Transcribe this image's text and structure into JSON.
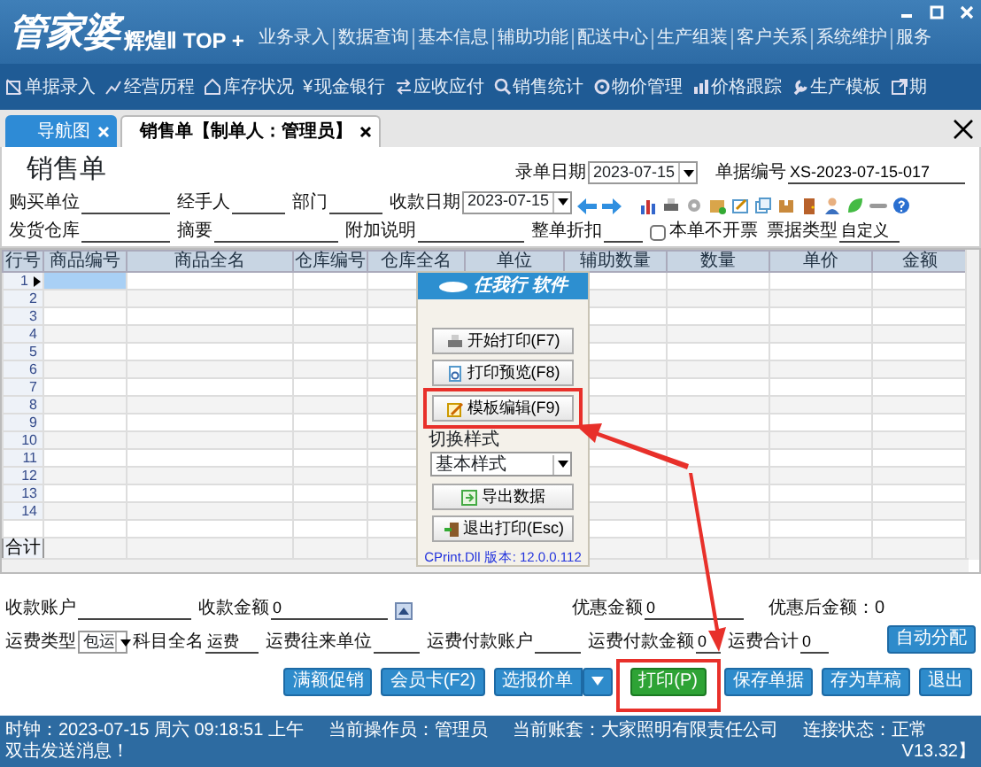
{
  "app": {
    "logo": "管家婆",
    "edition": "辉煌Ⅱ TOP +",
    "menu": [
      "业务录入",
      "数据查询",
      "基本信息",
      "辅助功能",
      "配送中心",
      "生产组装",
      "客户关系",
      "系统维护",
      "服务"
    ]
  },
  "toolbar": [
    {
      "label": "单据录入"
    },
    {
      "label": "经营历程"
    },
    {
      "label": "库存状况"
    },
    {
      "label": "现金银行",
      "glyph": "¥"
    },
    {
      "label": "应收应付"
    },
    {
      "label": "销售统计"
    },
    {
      "label": "物价管理"
    },
    {
      "label": "价格跟踪"
    },
    {
      "label": "生产模板"
    },
    {
      "label": "期"
    }
  ],
  "tabs": [
    {
      "label": "导航图",
      "selected": false
    },
    {
      "label": "销售单【制单人：管理员】",
      "selected": true
    }
  ],
  "form": {
    "title": "销售单",
    "entry_date": {
      "label": "录单日期",
      "value": "2023-07-15"
    },
    "doc_no": {
      "label": "单据编号",
      "value": "XS-2023-07-15-017"
    },
    "row1": [
      {
        "label": "购买单位"
      },
      {
        "label": "经手人"
      },
      {
        "label": "部门"
      },
      {
        "label": "收款日期",
        "value": "2023-07-15",
        "kind": "select"
      }
    ],
    "row2": [
      {
        "label": "发货仓库"
      },
      {
        "label": "摘要"
      },
      {
        "label": "附加说明"
      },
      {
        "label": "整单折扣"
      }
    ],
    "no_invoice": {
      "label": "本单不开票",
      "checked": false
    },
    "invoice_type": {
      "label": "票据类型",
      "value": "自定义"
    }
  },
  "grid": {
    "columns": [
      "行号",
      "商品编号",
      "商品全名",
      "仓库编号",
      "仓库全名",
      "单位",
      "辅助数量",
      "数量",
      "单价",
      "金额"
    ],
    "rows": [
      {
        "no": "1",
        "selected": true
      },
      {
        "no": "2",
        "selected": false
      },
      {
        "no": "3",
        "selected": false
      },
      {
        "no": "4",
        "selected": false
      },
      {
        "no": "5",
        "selected": false
      },
      {
        "no": "6",
        "selected": false
      },
      {
        "no": "7",
        "selected": false
      },
      {
        "no": "8",
        "selected": false
      },
      {
        "no": "9",
        "selected": false
      },
      {
        "no": "10",
        "selected": false
      },
      {
        "no": "11",
        "selected": false
      },
      {
        "no": "12",
        "selected": false
      },
      {
        "no": "13",
        "selected": false
      },
      {
        "no": "14",
        "selected": false
      }
    ],
    "footer": "合计"
  },
  "print_dialog": {
    "title": "任我行 软件",
    "buttons": [
      {
        "label": "开始打印(F7)",
        "annotated": false
      },
      {
        "label": "打印预览(F8)",
        "annotated": false
      },
      {
        "label": "模板编辑(F9)",
        "annotated": true
      }
    ],
    "style_label": "切换样式",
    "style_value": "基本样式",
    "extra_buttons": [
      {
        "label": "导出数据"
      },
      {
        "label": "退出打印(Esc)"
      }
    ],
    "version": "CPrint.Dll 版本: 12.0.0.112"
  },
  "bottom": {
    "row1": [
      {
        "label": "收款账户"
      },
      {
        "label": "收款金额",
        "value": "0"
      },
      {
        "label": "优惠金额",
        "value": "0"
      }
    ],
    "after_discount": "优惠后金额：0",
    "row2": [
      {
        "label": "运费类型",
        "value": "包运",
        "kind": "select"
      },
      {
        "label": "科目全名",
        "value": "运费"
      },
      {
        "label": "运费往来单位"
      },
      {
        "label": "运费付款账户"
      },
      {
        "label": "运费付款金额",
        "value": "0"
      },
      {
        "label": "运费合计",
        "value": "0"
      }
    ],
    "auto_button": "自动分配"
  },
  "actions": [
    {
      "label": "满额促销",
      "kind": "plain",
      "annotated": false
    },
    {
      "label": "会员卡(F2)",
      "kind": "plain",
      "annotated": false
    },
    {
      "label": "选报价单",
      "kind": "split",
      "annotated": false
    },
    {
      "label": "打印(P)",
      "kind": "primary",
      "annotated": true
    },
    {
      "label": "保存单据",
      "kind": "plain",
      "annotated": false
    },
    {
      "label": "存为草稿",
      "kind": "plain",
      "annotated": false
    },
    {
      "label": "退出",
      "kind": "plain",
      "annotated": false
    }
  ],
  "status_bar": [
    "时钟：2023-07-15 周六 09:18:51 上午",
    "当前操作员：管理员",
    "当前账套：大家照明有限责任公司",
    "连接状态：正常",
    "双击发送消息！",
    "V13.32】"
  ]
}
